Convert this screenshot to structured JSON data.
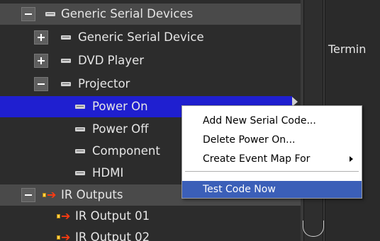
{
  "tree": {
    "rows": [
      {
        "label": "Generic Serial Devices",
        "icon": "serial-port-icon",
        "expander": "collapse"
      },
      {
        "label": "Generic Serial Device",
        "icon": "serial-port-icon",
        "expander": "expand"
      },
      {
        "label": "DVD Player",
        "icon": "serial-port-icon",
        "expander": "expand"
      },
      {
        "label": "Projector",
        "icon": "serial-port-icon",
        "expander": "collapse"
      },
      {
        "label": "Power On",
        "icon": "serial-port-icon",
        "selected": true
      },
      {
        "label": "Power Off",
        "icon": "serial-port-icon"
      },
      {
        "label": "Component",
        "icon": "serial-port-icon"
      },
      {
        "label": "HDMI",
        "icon": "serial-port-icon"
      },
      {
        "label": "IR Outputs",
        "icon": "ir-output-icon",
        "expander": "collapse"
      },
      {
        "label": "IR Output 01",
        "icon": "ir-output-icon"
      },
      {
        "label": "IR Output 02",
        "icon": "ir-output-icon"
      }
    ]
  },
  "right_panel": {
    "label": "Termin"
  },
  "context_menu": {
    "items": [
      {
        "label": "Add New Serial Code..."
      },
      {
        "label": "Delete Power On..."
      },
      {
        "label": "Create Event Map For",
        "submenu": true
      },
      {
        "label": "Test Code Now",
        "highlighted": true
      }
    ]
  },
  "colors": {
    "selection": "#1f1fd0",
    "menu_highlight": "#3b5fb8",
    "ir_arrow": "#ff3a10"
  }
}
